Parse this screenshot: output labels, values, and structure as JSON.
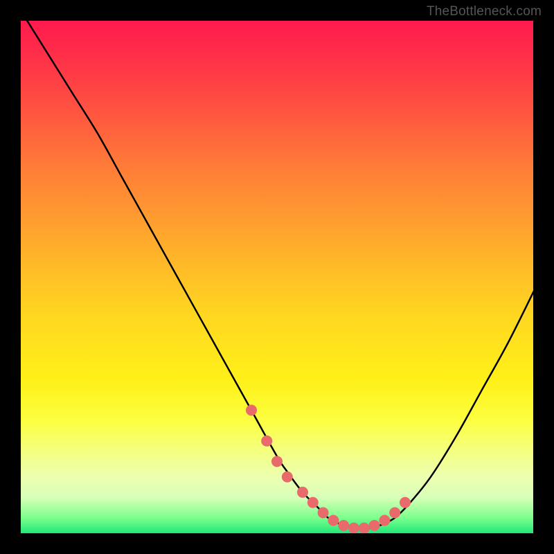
{
  "watermark": "TheBottleneck.com",
  "chart_data": {
    "type": "line",
    "title": "",
    "xlabel": "",
    "ylabel": "",
    "xlim": [
      0,
      100
    ],
    "ylim": [
      0,
      100
    ],
    "series": [
      {
        "name": "curve",
        "x": [
          0,
          5,
          10,
          15,
          20,
          25,
          30,
          35,
          40,
          45,
          50,
          52,
          55,
          58,
          60,
          63,
          65,
          68,
          70,
          73,
          76,
          80,
          85,
          90,
          95,
          100
        ],
        "y": [
          102,
          94,
          86,
          78,
          69,
          60,
          51,
          42,
          33,
          24,
          15,
          12,
          8,
          5,
          3,
          1.5,
          1,
          1,
          1.5,
          3,
          6,
          11,
          19,
          28,
          37,
          47
        ]
      }
    ],
    "markers": {
      "name": "points",
      "x": [
        45,
        48,
        50,
        52,
        55,
        57,
        59,
        61,
        63,
        65,
        67,
        69,
        71,
        73,
        75
      ],
      "y": [
        24,
        18,
        14,
        11,
        8,
        6,
        4,
        2.5,
        1.5,
        1,
        1,
        1.5,
        2.5,
        4,
        6
      ],
      "color": "#e86a6a",
      "size": 8
    },
    "background_gradient": {
      "top": "#ff1a4d",
      "mid": "#fff018",
      "bottom": "#20e878"
    }
  }
}
